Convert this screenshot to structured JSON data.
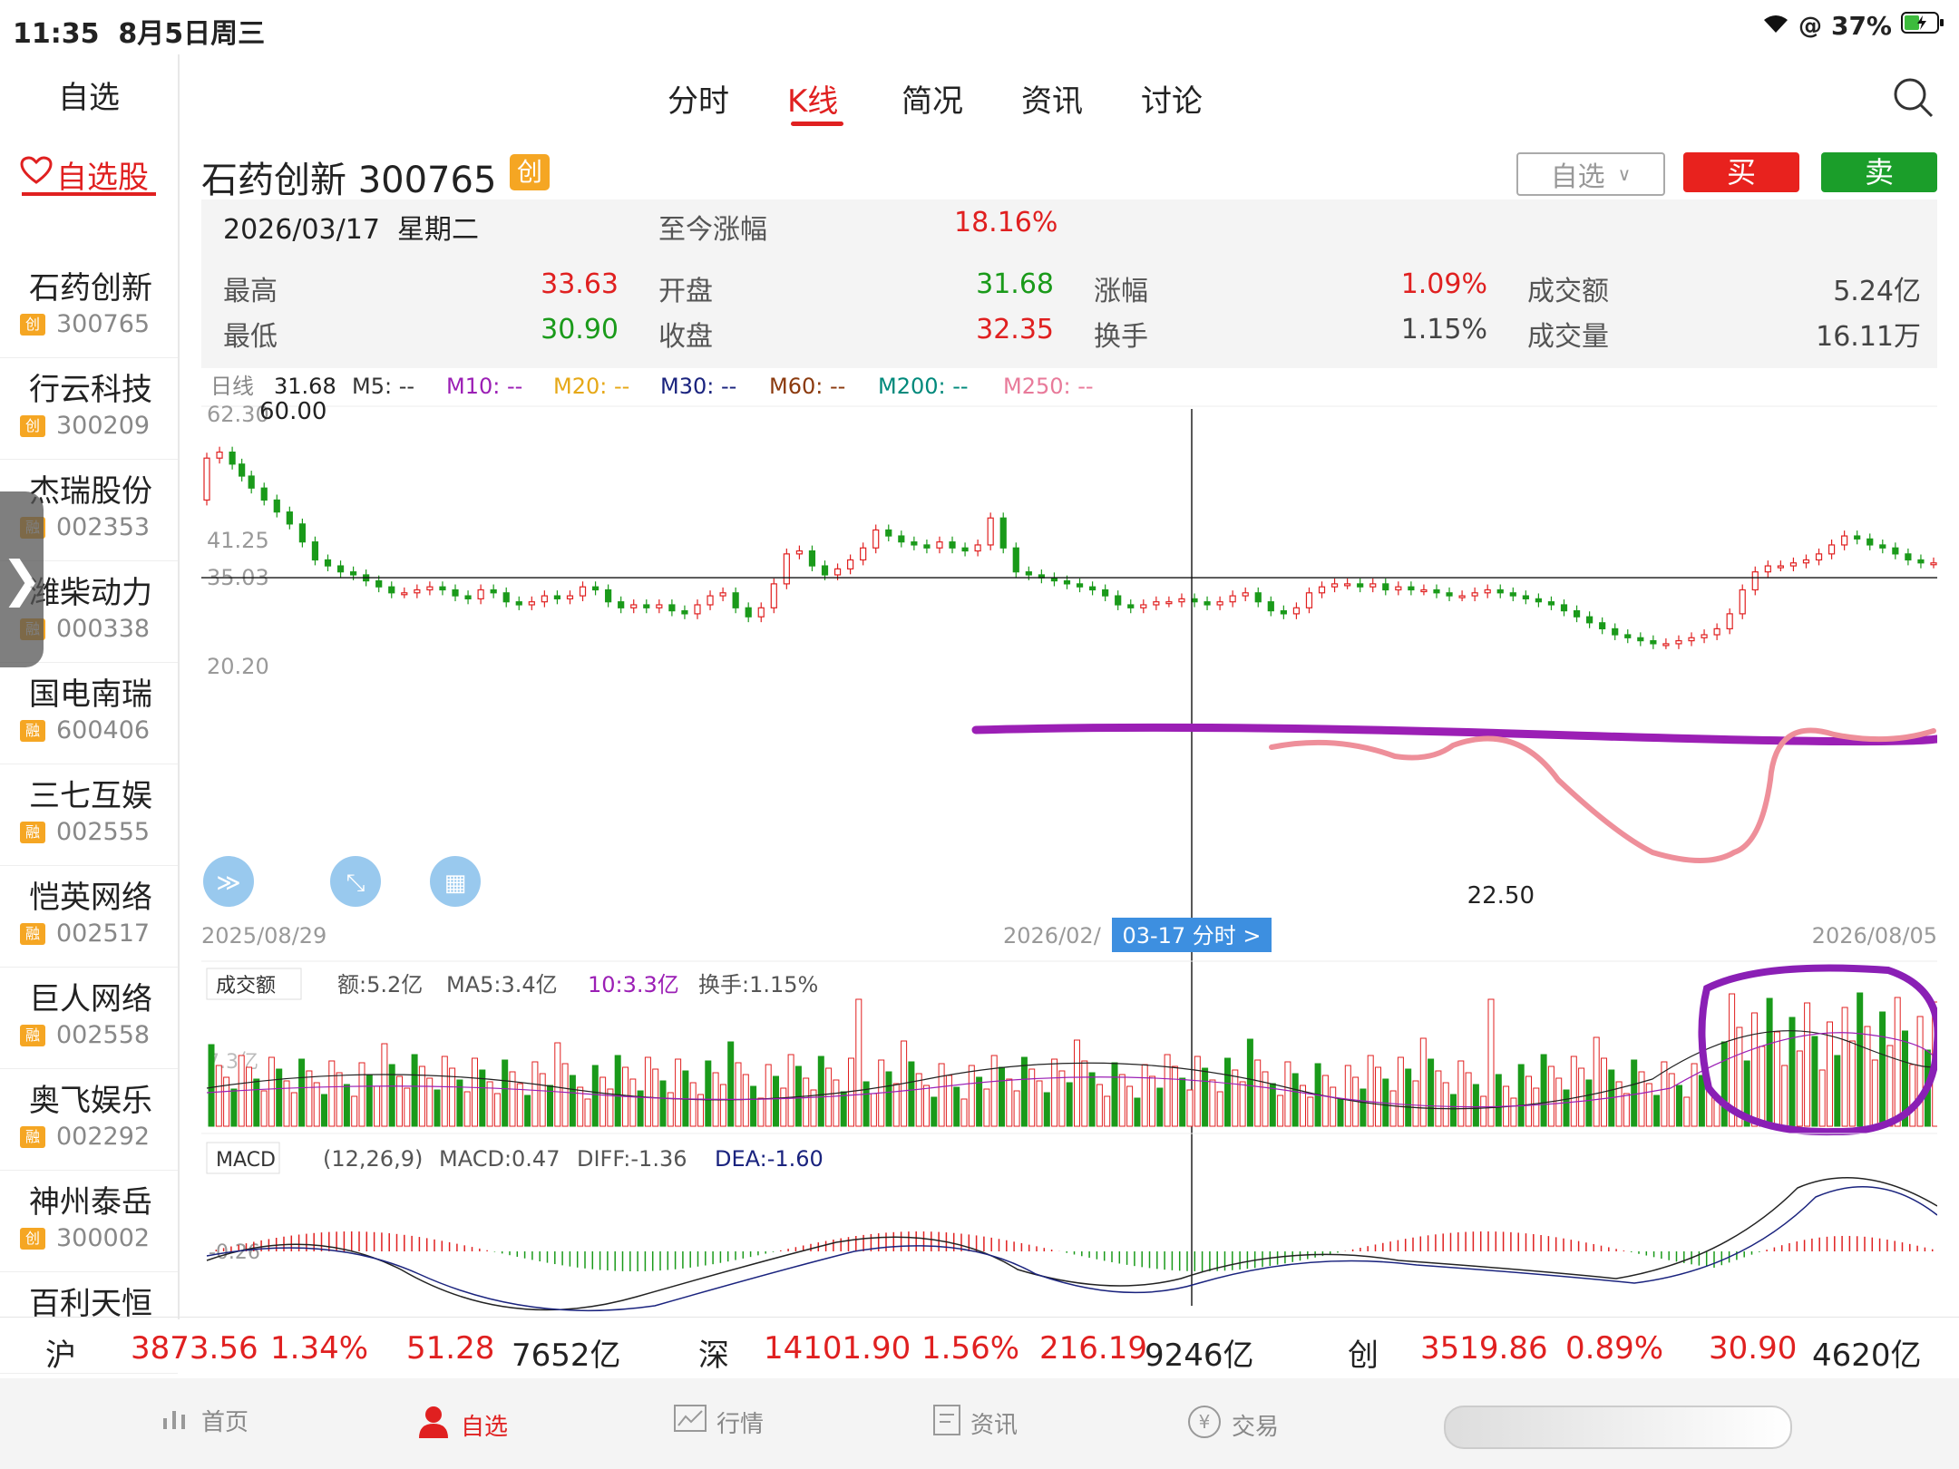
{
  "status": {
    "time": "11:35",
    "date": "8月5日周三",
    "battery": "37%"
  },
  "sidebar": {
    "title": "自选",
    "tab": "自选股",
    "items": [
      {
        "name": "石药创新",
        "code": "300765",
        "tag": "创"
      },
      {
        "name": "行云科技",
        "code": "300209",
        "tag": "创"
      },
      {
        "name": "杰瑞股份",
        "code": "002353",
        "tag": "融"
      },
      {
        "name": "潍柴动力",
        "code": "000338",
        "tag": "融"
      },
      {
        "name": "国电南瑞",
        "code": "600406",
        "tag": "融"
      },
      {
        "name": "三七互娱",
        "code": "002555",
        "tag": "融"
      },
      {
        "name": "恺英网络",
        "code": "002517",
        "tag": "融"
      },
      {
        "name": "巨人网络",
        "code": "002558",
        "tag": "融"
      },
      {
        "name": "奥飞娱乐",
        "code": "002292",
        "tag": "融"
      },
      {
        "name": "神州泰岳",
        "code": "300002",
        "tag": "创"
      },
      {
        "name": "百利天恒",
        "code": "",
        "tag": ""
      }
    ]
  },
  "nav": {
    "tabs": [
      "分时",
      "K线",
      "简况",
      "资讯",
      "讨论"
    ],
    "active": "K线"
  },
  "header": {
    "stock": "石药创新 300765",
    "badge": "创",
    "watch_label": "自选",
    "buy": "买",
    "sell": "卖"
  },
  "info": {
    "date": "2026/03/17",
    "weekday": "星期二",
    "since_label": "至今涨幅",
    "since_value": "18.16%",
    "rows": [
      [
        {
          "l": "最高",
          "v": "33.63",
          "c": "red"
        },
        {
          "l": "开盘",
          "v": "31.68",
          "c": "green"
        },
        {
          "l": "涨幅",
          "v": "1.09%",
          "c": "red"
        },
        {
          "l": "成交额",
          "v": "5.24亿",
          "c": "gray"
        }
      ],
      [
        {
          "l": "最低",
          "v": "30.90",
          "c": "green"
        },
        {
          "l": "收盘",
          "v": "32.35",
          "c": "red"
        },
        {
          "l": "换手",
          "v": "1.15%",
          "c": "gray"
        },
        {
          "l": "成交量",
          "v": "16.11万",
          "c": "gray"
        }
      ]
    ]
  },
  "chart_data": {
    "type": "candlestick",
    "ma_legend": [
      {
        "t": "日线",
        "c": "#888"
      },
      {
        "t": "31.68",
        "c": "#222"
      },
      {
        "t": "M5: --",
        "c": "#333"
      },
      {
        "t": "M10: --",
        "c": "#9b1fb5"
      },
      {
        "t": "M20: --",
        "c": "#e6a817"
      },
      {
        "t": "M30: --",
        "c": "#1a237e"
      },
      {
        "t": "M60: --",
        "c": "#8b3a0e"
      },
      {
        "t": "M200: --",
        "c": "#00897b"
      },
      {
        "t": "M250: --",
        "c": "#e87a9a"
      }
    ],
    "y_ticks": [
      "62.30",
      "41.25",
      "35.03",
      "20.20"
    ],
    "y_tick_values": [
      62.3,
      41.25,
      35.03,
      20.2
    ],
    "ylim": [
      20.2,
      62.3
    ],
    "high_marker": "60.00",
    "low_marker": "22.50",
    "x_start": "2025/08/29",
    "x_mid": "2026/02/",
    "x_end": "2026/08/05",
    "cursor_label": "03-17 分时 >",
    "cursor_price": 35.03,
    "volume": {
      "selector": "成交额",
      "amount": "额:5.2亿",
      "ma5": "MA5:3.4亿",
      "ma10": "10:3.3亿",
      "turnover": "换手:1.15%",
      "ymax_label": "7.3亿"
    },
    "macd": {
      "selector": "MACD",
      "params": "(12,26,9)",
      "macd": "MACD:0.47",
      "diff": "DIFF:-1.36",
      "dea": "DEA:-1.60",
      "y_label": "-0.26"
    },
    "price_path": [
      [
        0,
        48
      ],
      [
        4,
        55
      ],
      [
        8,
        56
      ],
      [
        11,
        54
      ],
      [
        14,
        52
      ],
      [
        18,
        50
      ],
      [
        22,
        48
      ],
      [
        26,
        46
      ],
      [
        30,
        44
      ],
      [
        34,
        41
      ],
      [
        38,
        38
      ],
      [
        42,
        37
      ],
      [
        46,
        36
      ],
      [
        50,
        35.5
      ],
      [
        54,
        34.5
      ],
      [
        58,
        33.5
      ],
      [
        62,
        32.5
      ],
      [
        66,
        32.5
      ],
      [
        70,
        33
      ],
      [
        74,
        33.5
      ],
      [
        78,
        33
      ],
      [
        82,
        32
      ],
      [
        86,
        31.5
      ],
      [
        90,
        33
      ],
      [
        94,
        32.5
      ],
      [
        98,
        31
      ],
      [
        102,
        30.5
      ],
      [
        106,
        31
      ],
      [
        110,
        32
      ],
      [
        114,
        31.5
      ],
      [
        118,
        32
      ],
      [
        122,
        33.5
      ],
      [
        126,
        33
      ],
      [
        130,
        31
      ],
      [
        134,
        30
      ],
      [
        138,
        30.5
      ],
      [
        142,
        30
      ],
      [
        146,
        30.5
      ],
      [
        150,
        29.5
      ],
      [
        154,
        29
      ],
      [
        158,
        30.5
      ],
      [
        162,
        32
      ],
      [
        166,
        32.5
      ],
      [
        170,
        30
      ],
      [
        174,
        28.5
      ],
      [
        178,
        30
      ],
      [
        182,
        34
      ],
      [
        186,
        39
      ],
      [
        190,
        39.5
      ],
      [
        194,
        37
      ],
      [
        198,
        35.5
      ],
      [
        202,
        36.5
      ],
      [
        206,
        38
      ],
      [
        210,
        40
      ],
      [
        214,
        43
      ],
      [
        218,
        42
      ],
      [
        222,
        41
      ],
      [
        226,
        40.5
      ],
      [
        230,
        40
      ],
      [
        234,
        41
      ],
      [
        238,
        40
      ],
      [
        242,
        39.5
      ],
      [
        246,
        40.5
      ],
      [
        250,
        45
      ],
      [
        254,
        40
      ],
      [
        258,
        36
      ],
      [
        262,
        35.5
      ],
      [
        266,
        35
      ],
      [
        270,
        34.5
      ],
      [
        274,
        34
      ],
      [
        278,
        33.5
      ],
      [
        282,
        33
      ],
      [
        286,
        32
      ],
      [
        290,
        30.5
      ],
      [
        294,
        30
      ],
      [
        298,
        30.5
      ],
      [
        302,
        31
      ],
      [
        306,
        31
      ],
      [
        310,
        31.5
      ],
      [
        314,
        31
      ],
      [
        318,
        30.5
      ],
      [
        322,
        31
      ],
      [
        326,
        32
      ],
      [
        330,
        32.5
      ],
      [
        334,
        31
      ],
      [
        338,
        29.5
      ],
      [
        342,
        29
      ],
      [
        346,
        30
      ],
      [
        350,
        32.5
      ],
      [
        354,
        33.5
      ],
      [
        358,
        34
      ],
      [
        362,
        34
      ],
      [
        366,
        33.5
      ],
      [
        370,
        34
      ],
      [
        374,
        33
      ],
      [
        378,
        33.5
      ],
      [
        382,
        33
      ],
      [
        386,
        33
      ],
      [
        390,
        32.5
      ],
      [
        394,
        32
      ],
      [
        398,
        32
      ],
      [
        402,
        32.5
      ],
      [
        406,
        33
      ],
      [
        410,
        32.5
      ],
      [
        414,
        32
      ],
      [
        418,
        31.5
      ],
      [
        422,
        31
      ],
      [
        426,
        30.5
      ],
      [
        430,
        29.5
      ],
      [
        434,
        28.5
      ],
      [
        438,
        27.5
      ],
      [
        442,
        26.5
      ],
      [
        446,
        25.5
      ],
      [
        450,
        25
      ],
      [
        454,
        24.5
      ],
      [
        458,
        24
      ],
      [
        462,
        24
      ],
      [
        466,
        24.5
      ],
      [
        470,
        25
      ],
      [
        474,
        25.5
      ],
      [
        478,
        26.5
      ],
      [
        482,
        29
      ],
      [
        486,
        33
      ],
      [
        490,
        36
      ],
      [
        494,
        37
      ],
      [
        498,
        37
      ],
      [
        502,
        37.5
      ],
      [
        506,
        38
      ],
      [
        510,
        39
      ],
      [
        514,
        40.5
      ],
      [
        518,
        42
      ],
      [
        522,
        41.5
      ],
      [
        526,
        40.5
      ],
      [
        530,
        40
      ],
      [
        534,
        39
      ],
      [
        538,
        38
      ],
      [
        542,
        37.5
      ]
    ]
  },
  "index_bar": {
    "sh": {
      "name": "沪",
      "price": "3873.56",
      "pct": "1.34%",
      "chg": "51.28",
      "amt": "7652亿"
    },
    "sz": {
      "name": "深",
      "price": "14101.90",
      "pct": "1.56%",
      "chg": "216.19",
      "amt": "9246亿"
    },
    "cy": {
      "name": "创",
      "price": "3519.86",
      "pct": "0.89%",
      "chg": "30.90",
      "amt": "4620亿"
    }
  },
  "bottom_nav": [
    "首页",
    "自选",
    "行情",
    "资讯",
    "交易"
  ]
}
